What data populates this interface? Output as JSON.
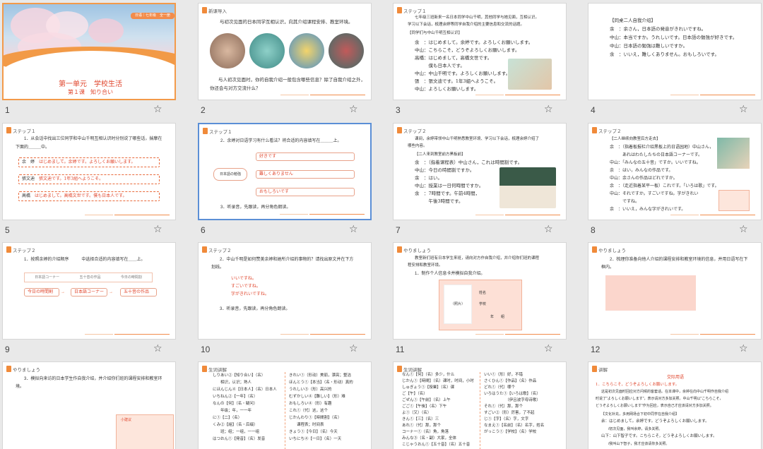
{
  "slides": [
    {
      "num": "1",
      "title_main": "第一单元　学校生活",
      "title_sub": "第１课　知り合い",
      "badge": "日语｜七年级　全一册"
    },
    {
      "num": "2",
      "header": "新课导入",
      "top_text": "与初次见面的日本同学互相认识，向其介绍课程安排、教室环境。",
      "bottom_text": "与人初次见面时，你的自我介绍一般包含哪些信息？除了自我介绍之外，",
      "bottom_text2": "你还会与对方交流什么？"
    },
    {
      "num": "3",
      "header": "ステップ１",
      "lines": [
        "七年级三班新来一名日本同学中山千明，其他同学与她见面，互相认识。",
        "学习以下会话，梳理余婷等同学自我介绍的主要信息和交流的话题。",
        "【同学们与中山千明互相认识】",
        "余　：はじめまして。余婷です。よろしくお願いします。",
        "中山：こちらこそ，どうぞよろしくお願いします。",
        "高橋：はじめまして，高橋文世です。",
        "　　　僕も日本人です。",
        "中山：中山千明です。よろしくお願いします。",
        "張　：張文迪です。1年3組へようこそ。",
        "中山：よろしくお願いします。"
      ]
    },
    {
      "num": "4",
      "header": "",
      "lines": [
        "【同桌二人自我介绍】",
        "余　：余さん，日本語の発音がきれいですね。",
        "中山：本当ですか。うれしいです。日本語の勉強が好きです。",
        "中山：日本語の勉強は難しいですか。",
        "余　：いいえ，難しくありません。おもしろいです。"
      ]
    },
    {
      "num": "5",
      "header": "ステップ１",
      "q1": "1．从会话中找出三位同学和中山千明互相认识时分别说了哪些话，揣摩在",
      "q2": "下面的＿＿＿中。",
      "rows": [
        {
          "name": "余　婷",
          "text": "はじめまして。余婷です。よろしくお願いします。"
        },
        {
          "name": "張文迪",
          "text": "張文迪です。1年3組へようこそ。"
        },
        {
          "name": "高橋",
          "text": "はじめまして。高橋文世です。僕も日本人です。"
        }
      ]
    },
    {
      "num": "6",
      "header": "ステップ１",
      "q": "2．余婷对日语学习有什么看法？将合适的内容填写在＿＿＿上。",
      "center": "日本語の勉強",
      "opts": [
        "好きです",
        "難しくありません",
        "おもしろいです"
      ],
      "q3": "3．听录音，先跟读，再分角色朗读。"
    },
    {
      "num": "7",
      "header": "ステップ２",
      "lines": [
        "课间，余婷带领中山千明熟悉教室环境、学习以下会话，梳理余婷介绍了",
        "哪些内容。",
        "【二人来到教室前方黑板前】",
        "余　：（指着课程表）中山さん，これは時間割です。",
        "中山：今日の時間割ですか。",
        "余　：はい。",
        "中山：授業は一日何時間ですか。",
        "余　：7時間です。午前4時間，",
        "　　　午後3時間です。"
      ]
    },
    {
      "num": "8",
      "header": "ステップ２",
      "lines": [
        "【二人继续向教室后方走去】",
        "余　：（指着板报栏介绍黑板上的日语园地）中山さん，",
        "　　　あれはわたしたちの日本語コーナーです。",
        "中山：「みんなの五十音」ですか。いいですね。",
        "余　：はい，みんなの作品です。",
        "中山：余さんの作品はどれですか。",
        "余　：（走近指着某平一板）これです。「いろは歌」です。",
        "中山：それですか。すごいですね。字がきれい",
        "　　　ですね。",
        "余　：いいえ，みんな字がきれいです。"
      ]
    },
    {
      "num": "9",
      "header": "ステップ２",
      "q": "1．按照余婷的介绍顺序　　　中选择合适的内容填写在＿＿上。",
      "small": [
        "日本語コーナー",
        "五十音の作品",
        "今日の時間割"
      ],
      "flow": [
        "今日の時間割",
        "日本語コーナー",
        "五十音の作品"
      ]
    },
    {
      "num": "10",
      "header": "ステップ２",
      "q1": "2．中山千明是如何赞美余婷和她所介绍的事物的？请找出原文并在下方",
      "q2": "划线。",
      "reds": [
        "いいですね。",
        "すごいですね。",
        "字がきれいですね。"
      ],
      "q3": "3．听录音，先跟读，再分角色朗读。"
    },
    {
      "num": "11",
      "header": "やりましょう",
      "t1": "教室新们班有日本学生来班，请向对方作自我介绍，并介绍你们班的课程",
      "t2": "程安排和教室环境。",
      "q": "1．制作个人信息卡并模拟自我介绍。",
      "photo": "（照片）",
      "f1": "姓名",
      "f2": "学校",
      "f3": "年　　組"
    },
    {
      "num": "12",
      "header": "やりましょう",
      "q1": "2．梳理你准备向他人介绍的课程安排和教室环境的信息，并用日语写在下",
      "q2": "框内。"
    },
    {
      "num": "13",
      "header": "やりましょう",
      "q1": "3．模拟向来访的日本学生作自我介绍，并介绍你们班的课程安排和教室环",
      "q2": "境。",
      "tip": "小建议"
    },
    {
      "num": "14",
      "header": "生词讲解",
      "left": [
        "しりあい②【知り合い】（名）",
        "　　相识，认识；熟人",
        "にほんじん④【日本人】（名）日本人",
        "いちねん②【一年】（名）",
        "なんの【何】（名・疑问）",
        "　　年级；年，一一年",
        "に①【二】（名）",
        "くみ②【組】（名・后缀）",
        "　　班；组；一组，一一组",
        "はつおん①【発音】（名）发音"
      ],
      "right": [
        "きれい①（形动）美丽，漂亮；整洁",
        "ほんとう①【本当】（名・形动）真的",
        "うれしい③（形）高兴的",
        "むずかしい④【難しい】（形）难",
        "おもしろい④（形）有趣",
        "これ①（代）这，这个",
        "じかんわり①【時間割】（名）",
        "　　课程表；时间表",
        "きょう①【今日】（名）今天",
        "いちにち④【一日】（名）一天"
      ]
    },
    {
      "num": "15",
      "header": "生词讲解",
      "left": [
        "なん①【何】（名）多少，什么",
        "じかん①【時間】（名）课时，时间，小时",
        "しゅぎょう①【授業】（名）课",
        "ご【午】（名）",
        "ごぜん①【午前】（名）上午",
        "ごご①【午後】（名）下午",
        "よ①（又）（名）",
        "きん①【三】（名）三",
        "あれ①（代）那，那个",
        "コーナー①（名）角，角落",
        "みんな③（名・副）大家，全体",
        "こじゃうおん①【五十音】（名）五十音"
      ],
      "right": [
        "いい①（形）好，不错",
        "さくひん①【作品】（名）作品",
        "どれ①（代）哪个",
        "いろはうた①【いろは歌】（名）",
        "　　　　　　（伊吕波字母诗歌）",
        "それ①（代）那，那个",
        "すごい②（形）厉害，了不起",
        "じ①【字】（名）字，文字",
        "なまえ①【名前】（名）名字，姓名",
        "がっこう①【学校】（名）学校"
      ]
    },
    {
      "num": "16",
      "header": "讲解",
      "title": "交际用语",
      "l1": "1．こちらこそ，どうぞよろしくお願いします。",
      "l2": "这是初次见面时回应对方问候的客套话。在本课中，余婷在向中山千明作自我介绍",
      "l3": "时说了\"よろしくお願いします\"，表示请对方多加关照。中山千明以\"こちらこそ，",
      "l4": "どうぞよろしくお願いします\"作为回应，表示自己才应该请对方多加关照。",
      "l5": "【文化补充，多用网场合下初中同学在自我介绍】",
      "l6": "余：はじめまして。余婷です。どうぞよろしくお願いします。",
      "l7": "　　/初次见面，我叫余婷，请多关照。",
      "l8": "山下：山下智子です。こちらこそ，どうぞよろしくお願いします。",
      "l9": "　　/我叫山下智子，我才应该请你多关照。"
    }
  ],
  "colors": {
    "accent": "#f28c4b",
    "red": "#e0462d",
    "select_border": "#5b8fd6"
  },
  "icons": {
    "star": "star-icon",
    "slide_tag": "slide-tag-icon"
  }
}
